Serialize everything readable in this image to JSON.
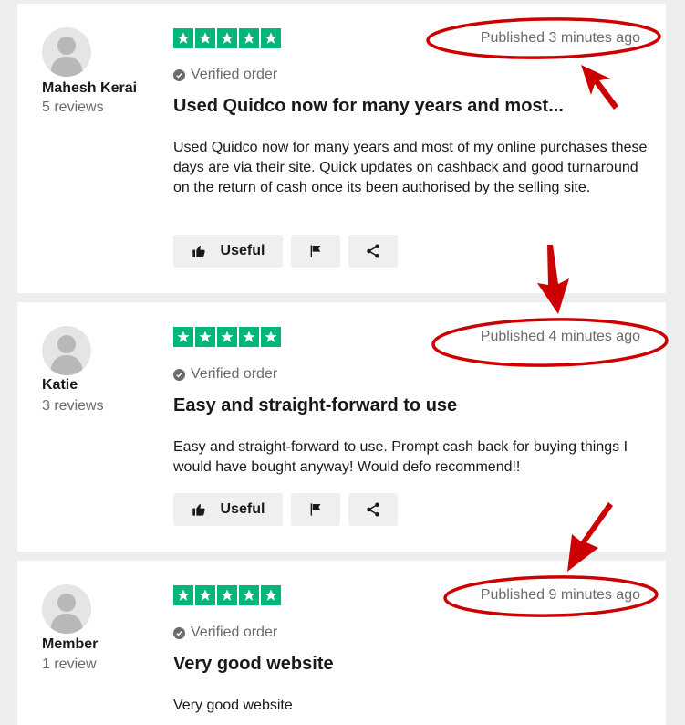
{
  "reviews": [
    {
      "reviewer_name": "Mahesh Kerai",
      "review_count": "5 reviews",
      "rating": 5,
      "published": "Published 3 minutes ago",
      "verified": "Verified order",
      "title": "Used Quidco now for many years and most...",
      "body": "Used Quidco now for many years and most of my online purchases these days are via their site. Quick updates on cashback and good turnaround on the return of cash once its been authorised by the selling site.",
      "useful_label": "Useful"
    },
    {
      "reviewer_name": "Katie",
      "review_count": "3 reviews",
      "rating": 5,
      "published": "Published 4 minutes ago",
      "verified": "Verified order",
      "title": "Easy and straight-forward to use",
      "body": "Easy and straight-forward to use. Prompt cash back for buying things I would have bought anyway! Would defo recommend!!",
      "useful_label": "Useful"
    },
    {
      "reviewer_name": "Member",
      "review_count": "1 review",
      "rating": 5,
      "published": "Published 9 minutes ago",
      "verified": "Verified order",
      "title": "Very good website",
      "body": "Very good website"
    }
  ],
  "colors": {
    "star_green": "#00b67a",
    "annotation_red": "#cc0000",
    "page_background": "#edeef0"
  }
}
